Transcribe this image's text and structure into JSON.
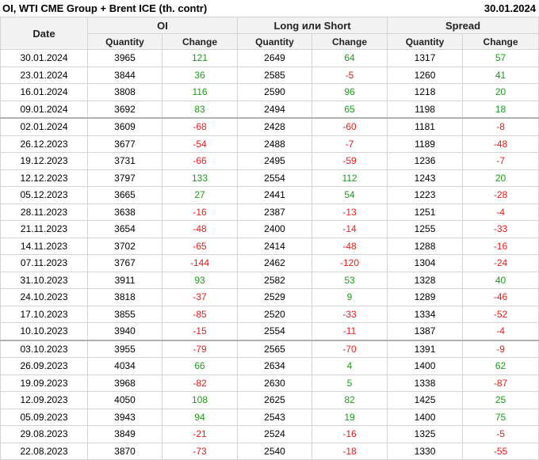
{
  "header": {
    "title": "OI, WTI CME Group + Brent ICE (th. contr)",
    "date": "30.01.2024"
  },
  "columns": {
    "date": "Date",
    "groups": [
      "OI",
      "Long или Short",
      "Spread"
    ],
    "quantity": "Quantity",
    "change": "Change"
  },
  "rows": [
    [
      "30.01.2024",
      "3965",
      "121",
      "2649",
      "64",
      "1317",
      "57"
    ],
    [
      "23.01.2024",
      "3844",
      "36",
      "2585",
      "-5",
      "1260",
      "41"
    ],
    [
      "16.01.2024",
      "3808",
      "116",
      "2590",
      "96",
      "1218",
      "20"
    ],
    [
      "09.01.2024",
      "3692",
      "83",
      "2494",
      "65",
      "1198",
      "18"
    ],
    [
      "02.01.2024",
      "3609",
      "-68",
      "2428",
      "-60",
      "1181",
      "-8"
    ],
    [
      "26.12.2023",
      "3677",
      "-54",
      "2488",
      "-7",
      "1189",
      "-48"
    ],
    [
      "19.12.2023",
      "3731",
      "-66",
      "2495",
      "-59",
      "1236",
      "-7"
    ],
    [
      "12.12.2023",
      "3797",
      "133",
      "2554",
      "112",
      "1243",
      "20"
    ],
    [
      "05.12.2023",
      "3665",
      "27",
      "2441",
      "54",
      "1223",
      "-28"
    ],
    [
      "28.11.2023",
      "3638",
      "-16",
      "2387",
      "-13",
      "1251",
      "-4"
    ],
    [
      "21.11.2023",
      "3654",
      "-48",
      "2400",
      "-14",
      "1255",
      "-33"
    ],
    [
      "14.11.2023",
      "3702",
      "-65",
      "2414",
      "-48",
      "1288",
      "-16"
    ],
    [
      "07.11.2023",
      "3767",
      "-144",
      "2462",
      "-120",
      "1304",
      "-24"
    ],
    [
      "31.10.2023",
      "3911",
      "93",
      "2582",
      "53",
      "1328",
      "40"
    ],
    [
      "24.10.2023",
      "3818",
      "-37",
      "2529",
      "9",
      "1289",
      "-46"
    ],
    [
      "17.10.2023",
      "3855",
      "-85",
      "2520",
      "-33",
      "1334",
      "-52"
    ],
    [
      "10.10.2023",
      "3940",
      "-15",
      "2554",
      "-11",
      "1387",
      "-4"
    ],
    [
      "03.10.2023",
      "3955",
      "-79",
      "2565",
      "-70",
      "1391",
      "-9"
    ],
    [
      "26.09.2023",
      "4034",
      "66",
      "2634",
      "4",
      "1400",
      "62"
    ],
    [
      "19.09.2023",
      "3968",
      "-82",
      "2630",
      "5",
      "1338",
      "-87"
    ],
    [
      "12.09.2023",
      "4050",
      "108",
      "2625",
      "82",
      "1425",
      "25"
    ],
    [
      "05.09.2023",
      "3943",
      "94",
      "2543",
      "19",
      "1400",
      "75"
    ],
    [
      "29.08.2023",
      "3849",
      "-21",
      "2524",
      "-16",
      "1325",
      "-5"
    ],
    [
      "22.08.2023",
      "3870",
      "-73",
      "2540",
      "-18",
      "1330",
      "-55"
    ]
  ],
  "separator_rows": [
    4,
    17
  ],
  "colors": {
    "positive": "#1e9a1e",
    "negative": "#e02020",
    "header_bg": "#f2f2f2",
    "border": "#d4d4d4"
  }
}
